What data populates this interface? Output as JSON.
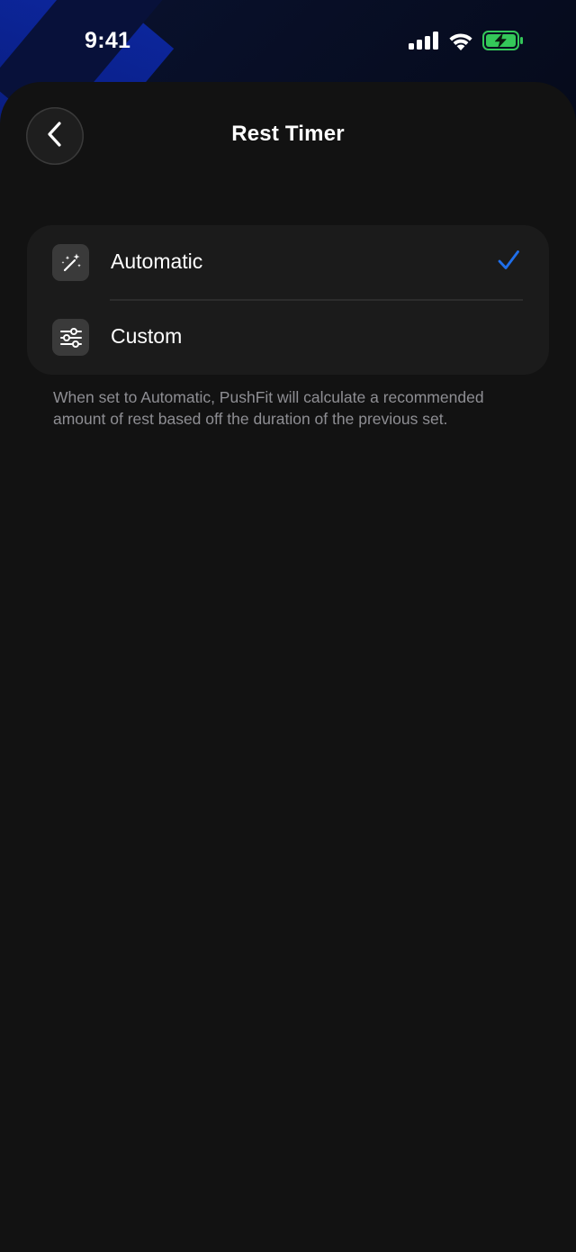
{
  "status_bar": {
    "time": "9:41",
    "icons": [
      "cellular-signal-icon",
      "wifi-icon",
      "battery-charging-icon"
    ]
  },
  "header": {
    "title": "Rest Timer",
    "back_icon": "chevron-left-icon"
  },
  "options": [
    {
      "label": "Automatic",
      "icon": "magic-wand-icon",
      "selected": true
    },
    {
      "label": "Custom",
      "icon": "sliders-icon",
      "selected": false
    }
  ],
  "footnote": "When set to Automatic, PushFit will calculate a recommended amount of rest based off the duration of the previous set.",
  "colors": {
    "accent": "#1f6feb",
    "battery": "#34c759",
    "sheet_background": "#121212",
    "card_background": "#1b1b1b",
    "secondary_text": "#8e8e93"
  }
}
